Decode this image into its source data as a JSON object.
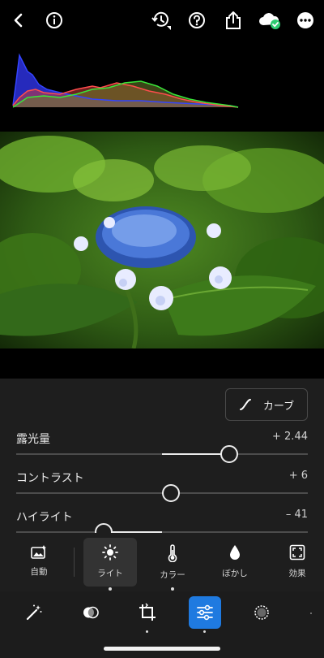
{
  "top_icons": [
    "back-icon",
    "info-icon",
    "history-icon",
    "help-icon",
    "share-icon",
    "cloud-sync-icon",
    "more-icon"
  ],
  "colors": {
    "accent": "#1f7ae0",
    "sync_ok": "#2ecc71",
    "panel_bg": "#1e1e1e",
    "histogram_blue": "#3344ff",
    "histogram_red": "#ff4d4d",
    "histogram_green": "#39e639"
  },
  "curve_button": {
    "label": "カーブ",
    "icon": "curve-icon"
  },
  "sliders": [
    {
      "label": "露光量",
      "value": "+ 2.44",
      "level": 0.73
    },
    {
      "label": "コントラスト",
      "value": "+ 6",
      "level": 0.53
    },
    {
      "label": "ハイライト",
      "value": "– 41",
      "level": 0.3
    }
  ],
  "categories": [
    {
      "label": "自動",
      "icon": "auto-photo-icon"
    },
    {
      "label": "ライト",
      "icon": "sun-icon",
      "active": true
    },
    {
      "label": "カラー",
      "icon": "thermometer-icon"
    },
    {
      "label": "ぼかし",
      "icon": "droplet-icon"
    },
    {
      "label": "効果",
      "icon": "effects-frame-icon"
    }
  ],
  "tools": [
    "magic-wand-icon",
    "masking-icon",
    "crop-rotate-icon",
    "edit-sliders-icon",
    "preset-circle-icon"
  ]
}
